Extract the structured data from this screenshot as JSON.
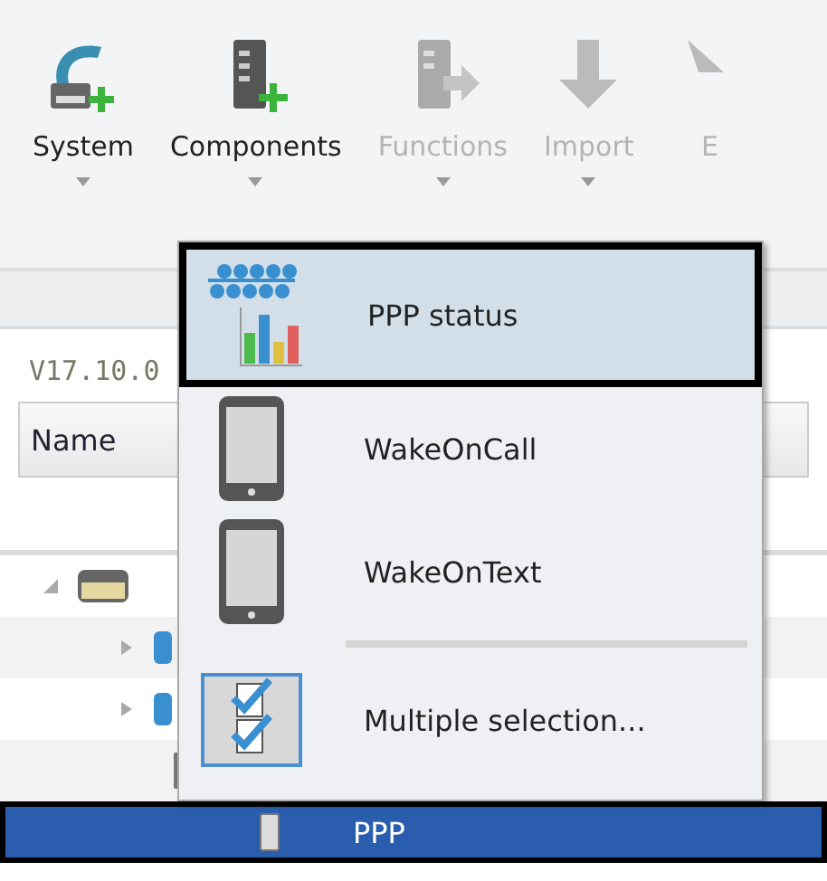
{
  "toolbar": {
    "items": [
      {
        "label": "System",
        "kind": "system",
        "disabled": false,
        "has_dropdown": true
      },
      {
        "label": "Components",
        "kind": "components",
        "disabled": false,
        "has_dropdown": true
      },
      {
        "label": "Functions",
        "kind": "functions",
        "disabled": true,
        "has_dropdown": true
      },
      {
        "label": "Import",
        "kind": "import",
        "disabled": true,
        "has_dropdown": true
      },
      {
        "label": "E",
        "kind": "export",
        "disabled": true,
        "has_dropdown": false
      }
    ]
  },
  "version": "V17.10.0",
  "table": {
    "columns": [
      "Name"
    ],
    "rows": [
      {
        "kind": "device",
        "expanded": true,
        "selected": false,
        "children": [
          {
            "kind": "module",
            "expanded": false,
            "selected": false
          },
          {
            "kind": "module",
            "expanded": false,
            "selected": false
          },
          {
            "kind": "usb",
            "selected": false
          },
          {
            "kind": "phone",
            "label": "PPP",
            "selected": true
          }
        ]
      }
    ]
  },
  "menu": {
    "items": [
      {
        "label": "PPP status",
        "kind": "status",
        "selected": true
      },
      {
        "label": "WakeOnCall",
        "kind": "phone",
        "selected": false
      },
      {
        "label": "WakeOnText",
        "kind": "phone",
        "selected": false
      },
      {
        "kind": "separator"
      },
      {
        "label": "Multiple selection...",
        "kind": "multi",
        "selected": false
      }
    ]
  }
}
